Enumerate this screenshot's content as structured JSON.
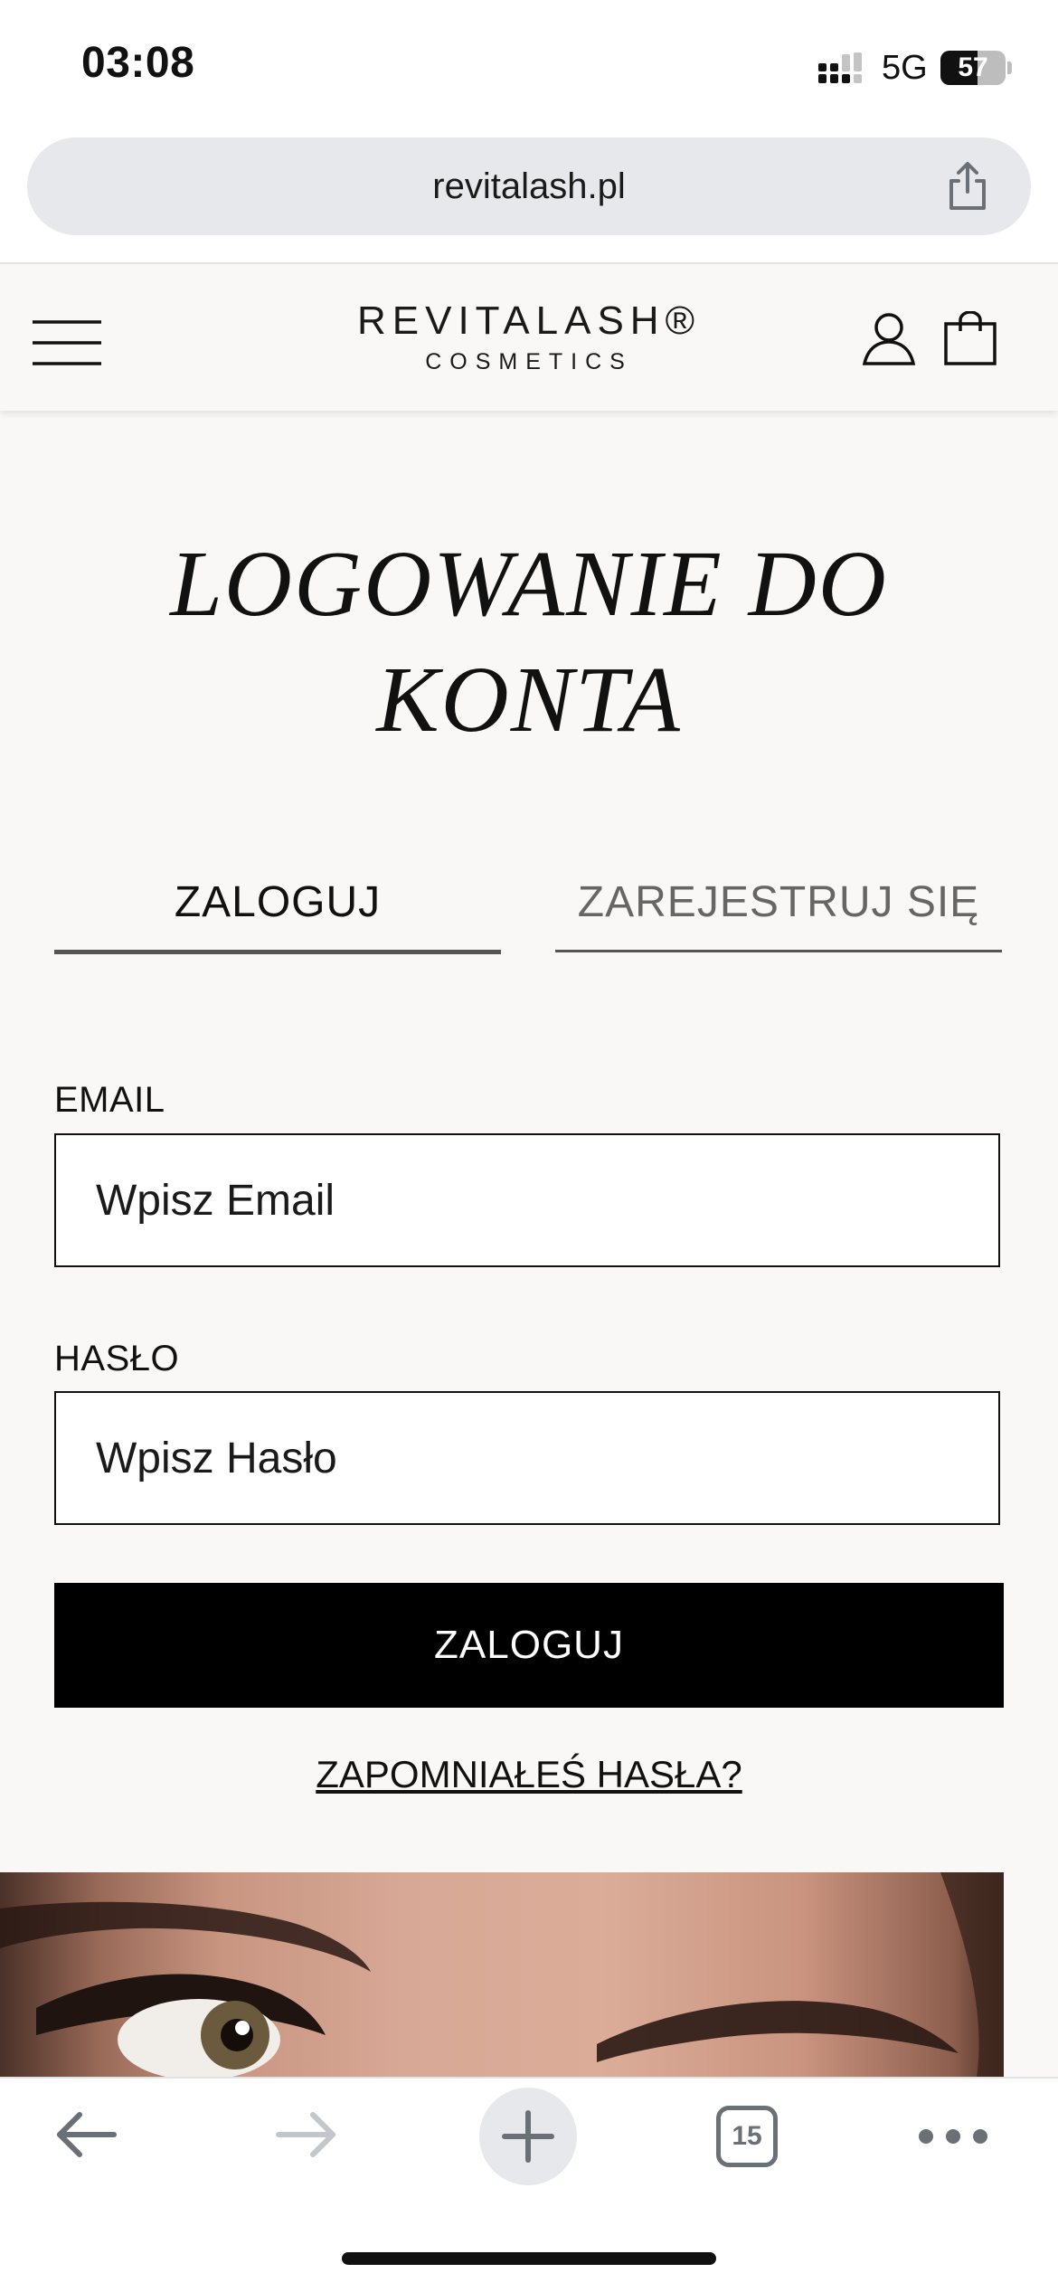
{
  "status_bar": {
    "time": "03:08",
    "network": "5G",
    "battery": "57",
    "battery_fraction": 0.57
  },
  "browser": {
    "url": "revitalash.pl",
    "tab_count": "15",
    "icons": {
      "share": "share-icon",
      "back": "back-arrow-icon",
      "forward": "forward-arrow-icon",
      "new_tab": "plus-icon",
      "more": "more-dots-icon"
    }
  },
  "header": {
    "logo_main": "REVITALASH®",
    "logo_sub": "COSMETICS",
    "icons": {
      "menu": "hamburger-menu-icon",
      "account": "user-icon",
      "cart": "shopping-bag-icon"
    }
  },
  "page": {
    "title": "LOGOWANIE DO KONTA",
    "tabs": [
      {
        "label": "ZALOGUJ",
        "active": true
      },
      {
        "label": "ZAREJESTRUJ SIĘ",
        "active": false
      }
    ],
    "form": {
      "email_label": "EMAIL",
      "email_placeholder": "Wpisz Email",
      "password_label": "HASŁO",
      "password_placeholder": "Wpisz Hasło",
      "submit_label": "ZALOGUJ",
      "forgot_label": "ZAPOMNIAŁEŚ HASŁA?"
    }
  },
  "colors": {
    "page_background": "#f9f8f6",
    "button_background": "#000000",
    "button_text": "#ffffff",
    "browser_pill": "#e6e8eb",
    "toolbar_icon": "#6b6f76"
  }
}
